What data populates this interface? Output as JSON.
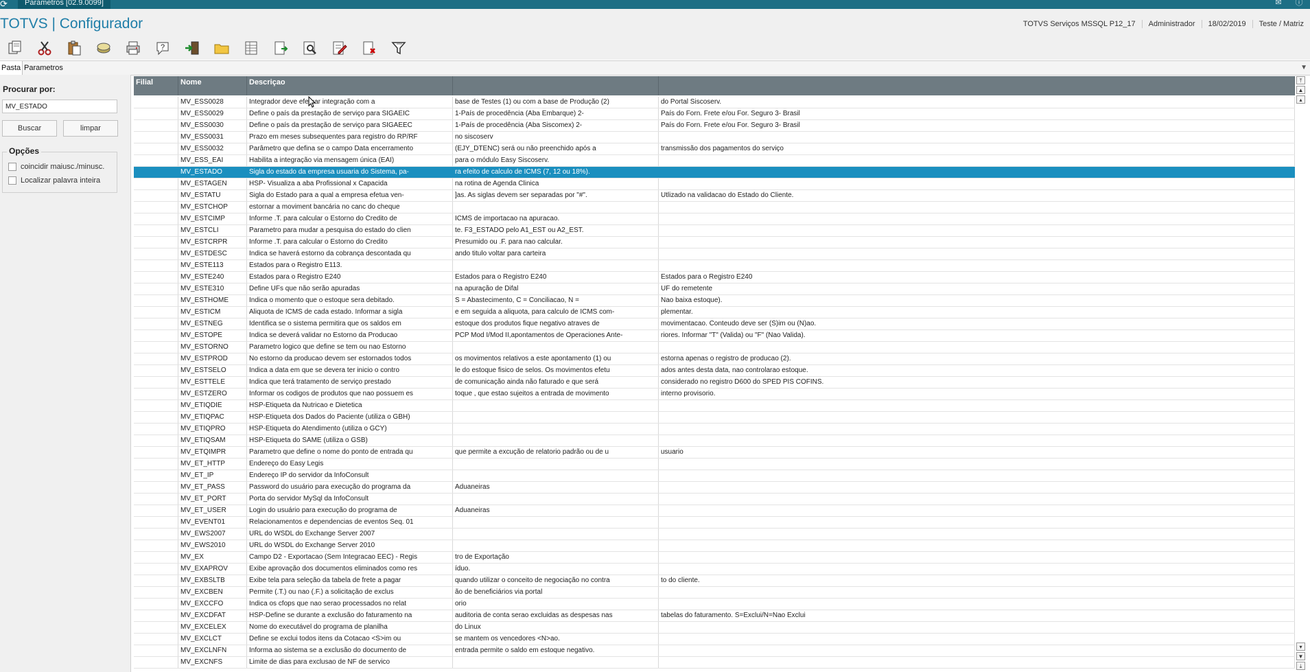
{
  "window": {
    "tab_label": "Parametros [02.9.0099]",
    "mail_icon": "mail-icon",
    "help_icon": "help-icon"
  },
  "header": {
    "title": "TOTVS | Configurador",
    "environment": "TOTVS Serviços MSSQL P12_17",
    "user": "Administrador",
    "date": "18/02/2019",
    "company": "Teste / Matriz"
  },
  "toolbar": {
    "icons": [
      "copy-icon",
      "cut-icon",
      "paste-icon",
      "database-icon",
      "print-icon",
      "help-icon",
      "exit-icon",
      "folder-icon",
      "table-icon",
      "export-icon",
      "preview-icon",
      "edit-icon",
      "delete-icon",
      "filter-icon"
    ]
  },
  "tabs": {
    "pasta": "Pasta",
    "parametros": "Parametros"
  },
  "search": {
    "label": "Procurar por:",
    "value": "MV_ESTADO",
    "buscar": "Buscar",
    "limpar": "limpar"
  },
  "options": {
    "title": "Opções",
    "items": [
      "coincidir maiusc./minusc.",
      "Localizar palavra inteira"
    ]
  },
  "grid": {
    "headers": [
      "Filial",
      "Nome",
      "Descriçao",
      "",
      ""
    ],
    "selected_index": 6,
    "rows": [
      [
        "",
        "MV_ESS0028",
        "Integrador deve efetuar integração com a",
        "base de Testes (1) ou com a base de Produção (2)",
        "do Portal Siscoserv."
      ],
      [
        "",
        "MV_ESS0029",
        "Define o país da prestação de serviço para SIGAEIC",
        "1-País de procedência (Aba Embarque) 2-",
        "País do Forn. Frete e/ou For. Seguro 3- Brasil"
      ],
      [
        "",
        "MV_ESS0030",
        "Define o país da prestação de serviço para SIGAEEC",
        "1-País de procedência (Aba Siscomex) 2-",
        "País do Forn. Frete e/ou For. Seguro 3- Brasil"
      ],
      [
        "",
        "MV_ESS0031",
        "Prazo em meses subsequentes para registro do RP/RF",
        " no siscoserv",
        ""
      ],
      [
        "",
        "MV_ESS0032",
        "Parâmetro que defina se o campo Data encerramento",
        "(EJY_DTENC) será ou não preenchido após a",
        "transmissão dos pagamentos do serviço"
      ],
      [
        "",
        "MV_ESS_EAI",
        "Habilita a integração via mensagem única (EAI)",
        "para o módulo Easy Siscoserv.",
        ""
      ],
      [
        "",
        "MV_ESTADO",
        "Sigla do estado da empresa usuaria do Sistema, pa-",
        "ra efeito de calculo de ICMS (7, 12 ou 18%).",
        ""
      ],
      [
        "",
        "MV_ESTAGEN",
        "HSP-  Visualiza  a  aba  Profissional  x  Capacida",
        "na rotina de Agenda Clinica",
        ""
      ],
      [
        "",
        "MV_ESTATU",
        "Sigla do Estado para a qual a empresa efetua ven-",
        "]as. As siglas devem ser separadas por \"#\".",
        "Utlizado na validacao do Estado do Cliente."
      ],
      [
        "",
        "MV_ESTCHOP",
        "estornar a moviment bancária no canc do cheque",
        "",
        ""
      ],
      [
        "",
        "MV_ESTCIMP",
        "Informe .T. para calcular o Estorno do Credito de",
        "ICMS de importacao na apuracao.",
        ""
      ],
      [
        "",
        "MV_ESTCLI",
        "Parametro para mudar a pesquisa do estado do clien",
        "te. F3_ESTADO pelo A1_EST ou A2_EST.",
        ""
      ],
      [
        "",
        "MV_ESTCRPR",
        "Informe .T. para calcular o Estorno do Credito",
        "Presumido ou .F. para nao calcular.",
        ""
      ],
      [
        "",
        "MV_ESTDESC",
        "Indica se haverá estorno da cobrança descontada qu",
        "ando titulo voltar para carteira",
        ""
      ],
      [
        "",
        "MV_ESTE113",
        "Estados para o Registro E113.",
        "",
        ""
      ],
      [
        "",
        "MV_ESTE240",
        "Estados para o Registro E240",
        "Estados para o Registro E240",
        "Estados para o Registro E240"
      ],
      [
        "",
        "MV_ESTE310",
        "Define UFs que não serão apuradas",
        "na apuração de Difal",
        "UF do remetente"
      ],
      [
        "",
        "MV_ESTHOME",
        "Indica o momento que o estoque sera debitado.",
        "S = Abastecimento, C = Conciliacao, N =",
        "Nao baixa estoque)."
      ],
      [
        "",
        "MV_ESTICM",
        "Aliquota de ICMS de cada estado. Informar a sigla",
        "e em seguida a aliquota, para calculo de ICMS com-",
        "plementar."
      ],
      [
        "",
        "MV_ESTNEG",
        "Identifica se o sistema permitira que os saldos em",
        "estoque dos produtos fique negativo atraves de",
        "movimentacao. Conteudo deve ser (S)im ou (N)ao."
      ],
      [
        "",
        "MV_ESTOPE",
        "Indica se deverá validar no Estorno da Producao",
        "PCP Mod I/Mod II,apontamentos de Operaciones Ante-",
        "riores. Informar \"T\" (Valida) ou \"F\" (Nao Valida)."
      ],
      [
        "",
        "MV_ESTORNO",
        "Parametro logico que define se tem ou nao Estorno",
        "",
        ""
      ],
      [
        "",
        "MV_ESTPROD",
        "No estorno da producao devem ser estornados todos",
        "os movimentos relativos a este apontamento (1) ou",
        "estorna apenas o registro de producao (2)."
      ],
      [
        "",
        "MV_ESTSELO",
        "Indica a data em que se devera ter inicio o contro",
        "le do estoque fisico de selos. Os movimentos efetu",
        "ados antes desta data, nao controlarao estoque."
      ],
      [
        "",
        "MV_ESTTELE",
        "Indica que terá tratamento de serviço prestado",
        "de comunicação ainda não faturado e que será",
        "considerado no registro D600 do SPED PIS COFINS."
      ],
      [
        "",
        "MV_ESTZERO",
        "Informar os codigos de produtos que nao possuem es",
        "toque , que estao sujeitos a entrada de movimento",
        "interno provisorio."
      ],
      [
        "",
        "MV_ETIQDIE",
        "HSP-Etiqueta da Nutricao e Dietetica",
        "",
        ""
      ],
      [
        "",
        "MV_ETIQPAC",
        "HSP-Etiqueta dos Dados do Paciente (utiliza o GBH)",
        "",
        ""
      ],
      [
        "",
        "MV_ETIQPRO",
        "HSP-Etiqueta do Atendimento (utiliza o GCY)",
        "",
        ""
      ],
      [
        "",
        "MV_ETIQSAM",
        "HSP-Etiqueta do SAME  (utiliza o GSB)",
        "",
        ""
      ],
      [
        "",
        "MV_ETQIMPR",
        "Parametro que define o nome do ponto de entrada qu",
        " que permite a excução de relatorio padrão ou de u",
        "usuario"
      ],
      [
        "",
        "MV_ET_HTTP",
        "Endereço do Easy Legis",
        "",
        ""
      ],
      [
        "",
        "MV_ET_IP",
        "Endereço IP do servidor da InfoConsult",
        "",
        ""
      ],
      [
        "",
        "MV_ET_PASS",
        "Password do usuário para execução do programa da",
        "Aduaneiras",
        ""
      ],
      [
        "",
        "MV_ET_PORT",
        "Porta do servidor MySql da InfoConsult",
        "",
        ""
      ],
      [
        "",
        "MV_ET_USER",
        "Login do usuário para execução do programa de",
        "Aduaneiras",
        ""
      ],
      [
        "",
        "MV_EVENT01",
        "Relacionamentos e dependencias de eventos Seq. 01",
        "",
        ""
      ],
      [
        "",
        "MV_EWS2007",
        "URL do WSDL do Exchange Server 2007",
        "",
        ""
      ],
      [
        "",
        "MV_EWS2010",
        "URL do WSDL do Exchange Server 2010",
        "",
        ""
      ],
      [
        "",
        "MV_EX",
        "Campo D2 - Exportacao (Sem Integracao EEC) - Regis",
        "tro de Exportação",
        ""
      ],
      [
        "",
        "MV_EXAPROV",
        "Exibe aprovação dos documentos eliminados como res",
        "íduo.",
        ""
      ],
      [
        "",
        "MV_EXBSLTB",
        "Exibe tela para seleção da tabela de frete a pagar",
        "quando utilizar o conceito de negociação no contra",
        "to do cliente."
      ],
      [
        "",
        "MV_EXCBEN",
        "Permite (.T.) ou nao (.F.) a solicitação de exclus",
        "ão de beneficiários via portal",
        ""
      ],
      [
        "",
        "MV_EXCCFO",
        "Indica os cfops que nao serao processados no relat",
        "orio",
        ""
      ],
      [
        "",
        "MV_EXCDFAT",
        "HSP-Define se durante a exclusão do faturamento na",
        "auditoria de conta serao excluidas as despesas nas",
        "tabelas do faturamento. S=Exclui/N=Nao Exclui"
      ],
      [
        "",
        "MV_EXCELEX",
        "Nome do executável do programa de planilha",
        "do Linux",
        ""
      ],
      [
        "",
        "MV_EXCLCT",
        "Define se exclui todos itens da Cotacao <S>im ou",
        "se mantem os vencedores <N>ao.",
        ""
      ],
      [
        "",
        "MV_EXCLNFN",
        "Informa ao sistema se a exclusão do documento de",
        "entrada permite o saldo em estoque negativo.",
        ""
      ],
      [
        "",
        "MV_EXCNFS",
        "Limite de dias para exclusao de NF de servico",
        "",
        ""
      ]
    ]
  }
}
